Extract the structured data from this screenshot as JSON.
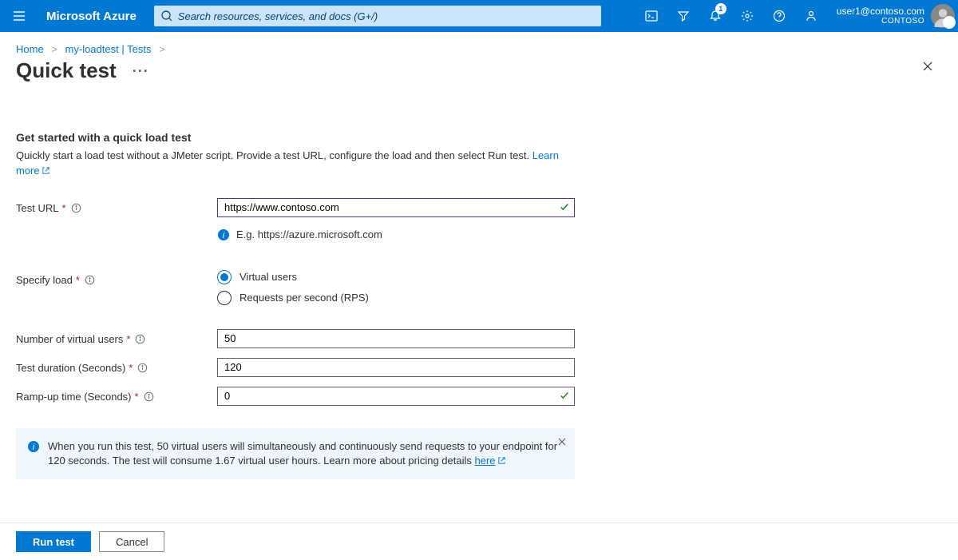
{
  "topbar": {
    "brand": "Microsoft Azure",
    "search_placeholder": "Search resources, services, and docs (G+/)",
    "notifications_badge": "1",
    "user_email": "user1@contoso.com",
    "user_tenant": "CONTOSO"
  },
  "breadcrumb": {
    "home": "Home",
    "resource": "my-loadtest",
    "resource_section": "Tests"
  },
  "page": {
    "title": "Quick test"
  },
  "section": {
    "heading": "Get started with a quick load test",
    "description": "Quickly start a load test without a JMeter script. Provide a test URL, configure the load and then select Run test. ",
    "learn_more": "Learn more"
  },
  "fields": {
    "test_url_label": "Test URL",
    "test_url_value": "https://www.contoso.com",
    "test_url_hint": "E.g. https://azure.microsoft.com",
    "specify_load_label": "Specify load",
    "radio_virtual_users": "Virtual users",
    "radio_rps": "Requests per second (RPS)",
    "num_users_label": "Number of virtual users",
    "num_users_value": "50",
    "duration_label": "Test duration (Seconds)",
    "duration_value": "120",
    "rampup_label": "Ramp-up time (Seconds)",
    "rampup_value": "0"
  },
  "banner": {
    "text_part1": "When you run this test, 50 virtual users will simultaneously and continuously send requests to your endpoint for 120 seconds. The test will consume 1.67 virtual user hours. Learn more about pricing details ",
    "here": "here"
  },
  "footer": {
    "run": "Run test",
    "cancel": "Cancel"
  }
}
